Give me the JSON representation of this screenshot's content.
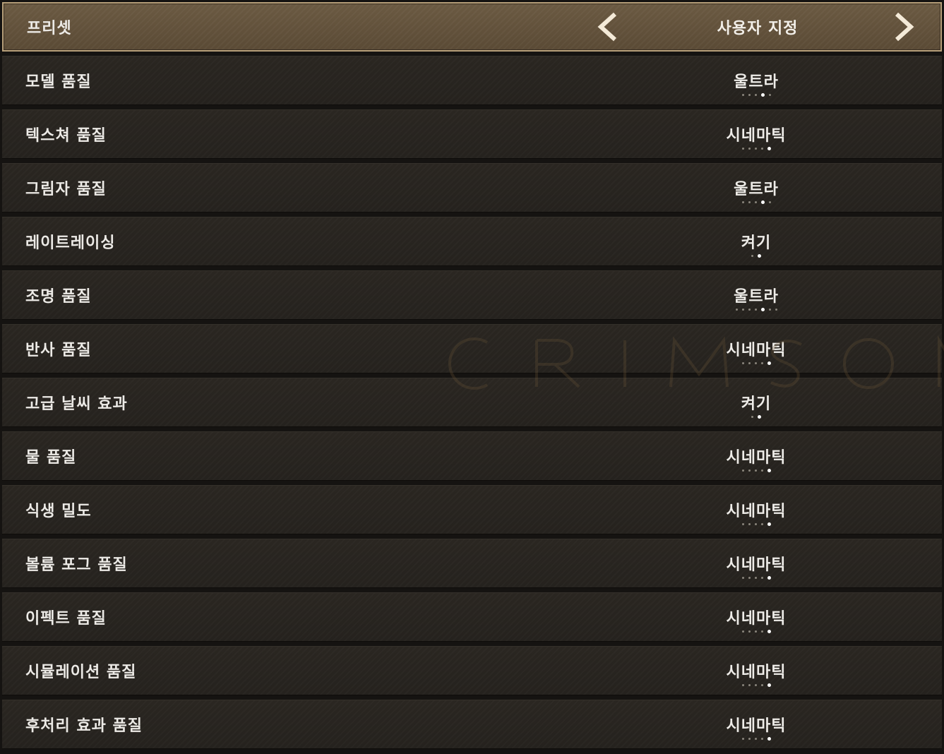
{
  "preset": {
    "label": "프리셋",
    "value": "사용자 지정",
    "prev_icon": "chevron-left-icon",
    "next_icon": "chevron-right-icon"
  },
  "watermark": "CRIMSON",
  "settings": [
    {
      "id": "model-quality",
      "label": "모델 품질",
      "value": "울트라",
      "level_index": 3,
      "level_count": 5
    },
    {
      "id": "texture-quality",
      "label": "텍스쳐 품질",
      "value": "시네마틱",
      "level_index": 4,
      "level_count": 5
    },
    {
      "id": "shadow-quality",
      "label": "그림자 품질",
      "value": "울트라",
      "level_index": 3,
      "level_count": 5
    },
    {
      "id": "ray-tracing",
      "label": "레이트레이싱",
      "value": "켜기",
      "level_index": 1,
      "level_count": 2
    },
    {
      "id": "lighting-quality",
      "label": "조명 품질",
      "value": "울트라",
      "level_index": 4,
      "level_count": 7
    },
    {
      "id": "reflection-quality",
      "label": "반사 품질",
      "value": "시네마틱",
      "level_index": 4,
      "level_count": 5
    },
    {
      "id": "advanced-weather",
      "label": "고급 날씨 효과",
      "value": "켜기",
      "level_index": 1,
      "level_count": 2
    },
    {
      "id": "water-quality",
      "label": "물 품질",
      "value": "시네마틱",
      "level_index": 4,
      "level_count": 5
    },
    {
      "id": "vegetation-density",
      "label": "식생 밀도",
      "value": "시네마틱",
      "level_index": 4,
      "level_count": 5
    },
    {
      "id": "volumetric-fog-quality",
      "label": "볼륨 포그 품질",
      "value": "시네마틱",
      "level_index": 4,
      "level_count": 5
    },
    {
      "id": "effect-quality",
      "label": "이펙트 품질",
      "value": "시네마틱",
      "level_index": 4,
      "level_count": 5
    },
    {
      "id": "simulation-quality",
      "label": "시뮬레이션 품질",
      "value": "시네마틱",
      "level_index": 4,
      "level_count": 5
    },
    {
      "id": "post-processing-quality",
      "label": "후처리 효과 품질",
      "value": "시네마틱",
      "level_index": 4,
      "level_count": 5
    }
  ]
}
